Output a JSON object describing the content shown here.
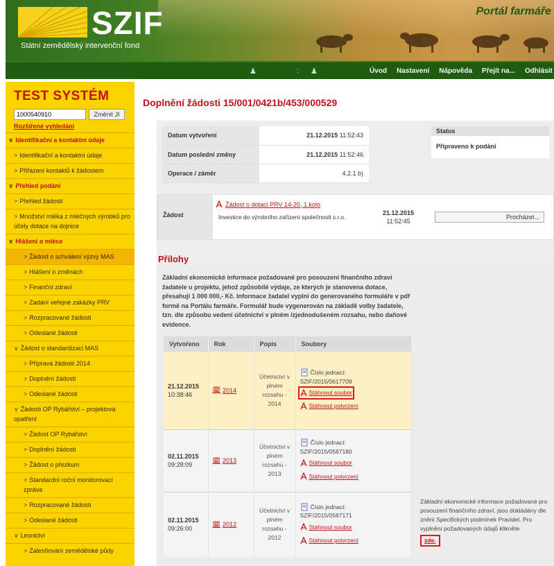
{
  "header": {
    "logo_text": "SZIF",
    "logo_subtitle": "Státní zemědělský intervenční fond",
    "portal_title": "Portál farmáře",
    "user_separator": ":",
    "nav": [
      "Úvod",
      "Nastavení",
      "Nápověda",
      "Přejít na...",
      "Odhlásit"
    ]
  },
  "sidebar": {
    "system_title": "TEST SYSTÉM",
    "id_value": "1000540910",
    "change_button": "Změnit JI",
    "advanced_search": "Rozšířené vyhledání",
    "items": [
      {
        "label": "Identifikační a kontaktní údaje",
        "type": "section",
        "arrow": "∨"
      },
      {
        "label": "Identifikační a kontaktní údaje",
        "type": "sub1",
        "arrow": ">"
      },
      {
        "label": "Přiřazení kontaktů k žádostem",
        "type": "sub1",
        "arrow": ">"
      },
      {
        "label": "Přehled podání",
        "type": "section",
        "arrow": "∨"
      },
      {
        "label": "Přehled žádostí",
        "type": "sub1",
        "arrow": ">"
      },
      {
        "label": "Množství mléka z mléčných výrobků pro účely dotace na dojnice",
        "type": "sub1",
        "arrow": ">"
      },
      {
        "label": "Hlášení o mléce",
        "type": "section",
        "arrow": "∨"
      },
      {
        "label": "Žádost o schválení výzvy MAS",
        "type": "sub2 active",
        "arrow": ">"
      },
      {
        "label": "Hlášení o změnách",
        "type": "sub2",
        "arrow": ">"
      },
      {
        "label": "Finanční zdraví",
        "type": "sub2",
        "arrow": ">"
      },
      {
        "label": "Zadání veřejné zakázky PRV",
        "type": "sub2",
        "arrow": ">"
      },
      {
        "label": "Rozpracované žádosti",
        "type": "sub2",
        "arrow": ">"
      },
      {
        "label": "Odeslané žádosti",
        "type": "sub2",
        "arrow": ">"
      },
      {
        "label": "Žádost o standardizaci MAS",
        "type": "section-sub",
        "arrow": "∨"
      },
      {
        "label": "Příprava žádosti 2014",
        "type": "sub2",
        "arrow": ">"
      },
      {
        "label": "Doplnění žádosti",
        "type": "sub2",
        "arrow": ">"
      },
      {
        "label": "Odeslané žádosti",
        "type": "sub2",
        "arrow": ">"
      },
      {
        "label": "Žádosti OP Rybářství – projektová opatření",
        "type": "section-sub",
        "arrow": "∨"
      },
      {
        "label": "Žádost OP Rybářství",
        "type": "sub2",
        "arrow": ">"
      },
      {
        "label": "Doplnění žádosti",
        "type": "sub2",
        "arrow": ">"
      },
      {
        "label": "Žádost o přezkum",
        "type": "sub2",
        "arrow": ">"
      },
      {
        "label": "Standardní roční monitorovací zpráva",
        "type": "sub2",
        "arrow": ">"
      },
      {
        "label": "Rozpracované žádosti",
        "type": "sub2",
        "arrow": ">"
      },
      {
        "label": "Odeslané žádosti",
        "type": "sub2",
        "arrow": ">"
      },
      {
        "label": "Lesnictví",
        "type": "section-sub",
        "arrow": "∨"
      },
      {
        "label": "Zalesňování zemědělské půdy",
        "type": "sub2",
        "arrow": ">"
      }
    ]
  },
  "main": {
    "title": "Doplnění žádosti 15/001/0421b/453/000529",
    "info": [
      {
        "key": "Datum vytvoření",
        "value": "21.12.2015",
        "time": "11:52:43"
      },
      {
        "key": "Datum poslední změny",
        "value": "21.12.2015",
        "time": "11:52:46"
      },
      {
        "key": "Operace / záměr",
        "value": "4.2.1 b)",
        "time": ""
      }
    ],
    "status": {
      "header": "Status",
      "value": "Připraveno k podání"
    },
    "zadost": {
      "label": "Žádost",
      "link": "Žádost o dotaci PRV 14-20, 1.kolo",
      "description": "Investice do výrobního zařízení společnosti s.r.o.",
      "date": "21.12.2015",
      "time": "11:52:45",
      "browse_button": "Procházet..."
    },
    "prilohy": {
      "title": "Přílohy",
      "description": "Základní ekonomické informace požadované pro posouzení finančního zdraví žadatele u projektu, jehož způsobilé výdaje, ze kterých je stanovena dotace, přesahují 1 000 000,- Kč. Informace žadatel vyplní do generovaného formuláře v pdf formě na Portálu farmáře. Formulář bude vygenerován na základě volby žadatele, tzn. dle způsobu vedení účetnictví v plném /zjednodušeném rozsahu, nebo daňové evidence.",
      "columns": [
        "Vytvořeno",
        "Rok",
        "Popis",
        "Soubory"
      ],
      "rows": [
        {
          "date": "21.12.2015",
          "time": "10:38:46",
          "year": "2014",
          "popis": "Účetnictví v plném rozsahu - 2014",
          "cislo_label": "Číslo jednací:",
          "cislo": "SZIF/2015/0617709",
          "download": "Stáhnout soubor",
          "confirm": "Stáhnout potvrzení"
        },
        {
          "date": "02.11.2015",
          "time": "09:28:09",
          "year": "2013",
          "popis": "Účetnictví v plném rozsahu - 2013",
          "cislo_label": "Číslo jednací:",
          "cislo": "SZIF/2015/0587180",
          "download": "Stáhnout soubor",
          "confirm": "Stáhnout potvrzení"
        },
        {
          "date": "02.11.2015",
          "time": "09:26:00",
          "year": "2012",
          "popis": "Účetnictví v plném rozsahu - 2012",
          "cislo_label": "Číslo jednací:",
          "cislo": "SZIF/2015/0587171",
          "download": "Stáhnout soubor",
          "confirm": "Stáhnout potvrzení"
        }
      ],
      "side_note": "Základní ekonomické informace požadované pro posouzení finančního zdraví, jsou dokládány dle znění Specifických podmínek Pravidel. Pro vyplnění požadovaných údajů klikněte",
      "side_link": "zde."
    }
  },
  "colors": {
    "brand_red": "#c2101a",
    "sidebar_yellow": "#fbd400",
    "nav_green": "#1f5c12",
    "highlight_red": "#e01818"
  }
}
